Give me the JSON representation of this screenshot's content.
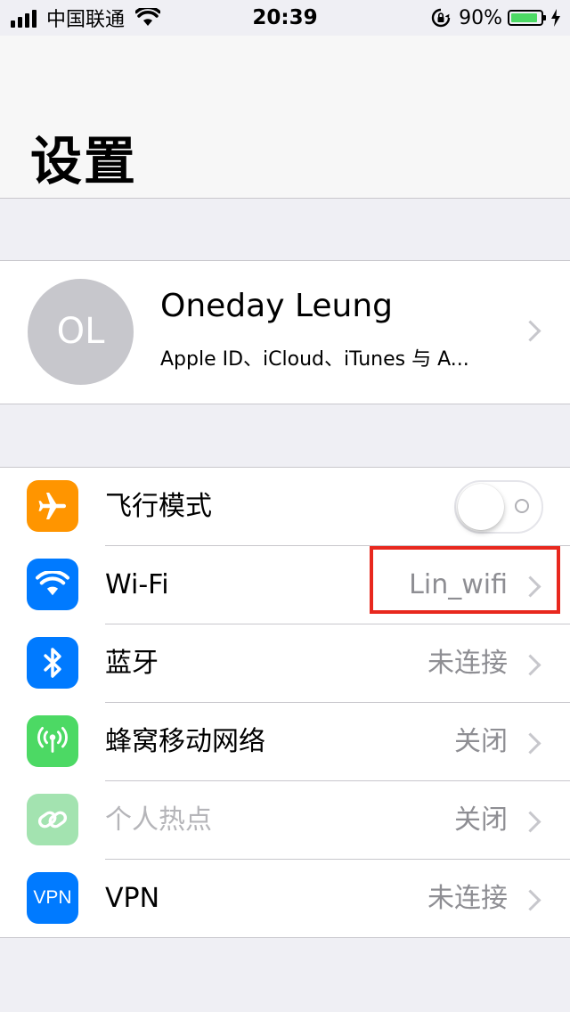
{
  "status_bar": {
    "carrier": "中国联通",
    "time": "20:39",
    "battery_percent": "90%",
    "battery_level": 0.9,
    "battery_color": "#4cd964"
  },
  "page_title": "设置",
  "profile": {
    "initials": "OL",
    "name": "Oneday Leung",
    "subtitle": "Apple ID、iCloud、iTunes 与 A..."
  },
  "settings": [
    {
      "key": "airplane",
      "label": "飞行模式",
      "icon": "airplane-icon",
      "icon_color": "#ff9500",
      "toggle_on": false
    },
    {
      "key": "wifi",
      "label": "Wi-Fi",
      "value": "Lin_wifi",
      "icon": "wifi-icon",
      "icon_color": "#007aff"
    },
    {
      "key": "bluetooth",
      "label": "蓝牙",
      "value": "未连接",
      "icon": "bluetooth-icon",
      "icon_color": "#007aff"
    },
    {
      "key": "cellular",
      "label": "蜂窝移动网络",
      "value": "关闭",
      "icon": "cellular-antenna-icon",
      "icon_color": "#4cd964"
    },
    {
      "key": "hotspot",
      "label": "个人热点",
      "value": "关闭",
      "icon": "hotspot-link-icon",
      "icon_color": "#a3e3b0",
      "disabled": true
    },
    {
      "key": "vpn",
      "label": "VPN",
      "value": "未连接",
      "icon": "vpn-icon",
      "icon_text": "VPN",
      "icon_color": "#007aff"
    }
  ],
  "highlight_color": "#e8281e"
}
